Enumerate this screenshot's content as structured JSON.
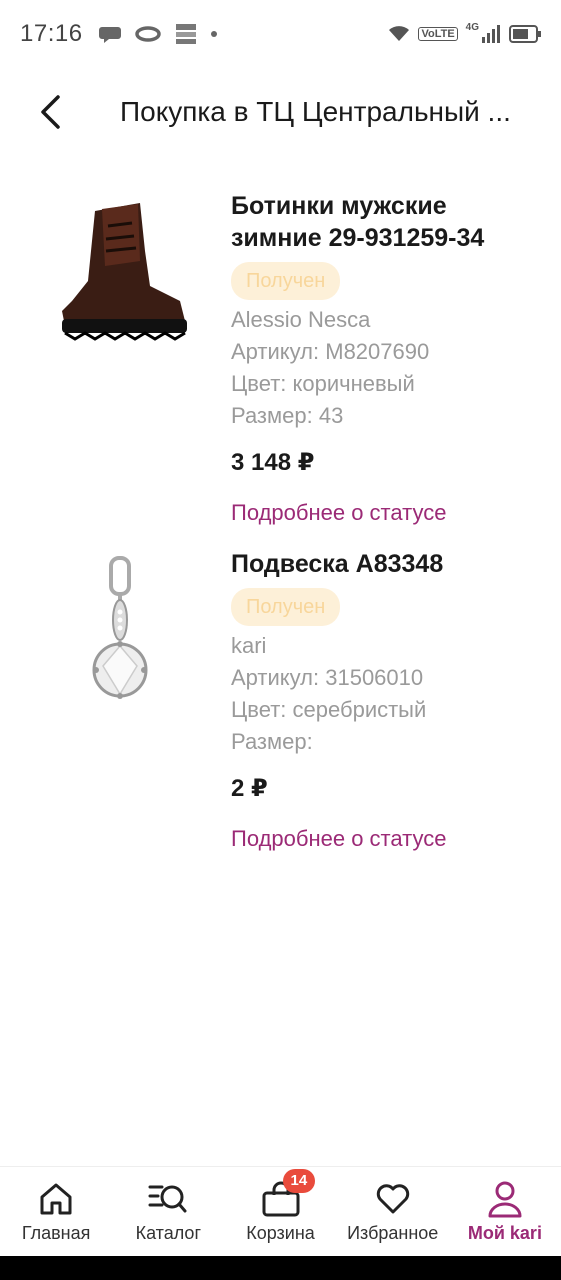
{
  "status_bar": {
    "time": "17:16",
    "network_label": "VoLTE",
    "network_gen": "4G"
  },
  "header": {
    "title": "Покупка в ТЦ Центральный ..."
  },
  "items": [
    {
      "name": "Ботинки мужские зимние 29-931259-34",
      "status": "Получен",
      "brand": "Alessio Nesca",
      "article": "Артикул: M8207690",
      "color": "Цвет: коричневый",
      "size": "Размер: 43",
      "price": "3 148 ₽",
      "link": "Подробнее о статусе",
      "image_icon": "boot-image"
    },
    {
      "name": "Подвеска A83348",
      "status": "Получен",
      "brand": "kari",
      "article": "Артикул: 31506010",
      "color": "Цвет: серебристый",
      "size": "Размер:",
      "price": "2 ₽",
      "link": "Подробнее о статусе",
      "image_icon": "pendant-image"
    }
  ],
  "bottom_nav": {
    "items": [
      {
        "label": "Главная",
        "icon": "home-icon"
      },
      {
        "label": "Каталог",
        "icon": "catalog-search-icon"
      },
      {
        "label": "Корзина",
        "icon": "cart-bag-icon",
        "badge": "14"
      },
      {
        "label": "Избранное",
        "icon": "heart-icon"
      },
      {
        "label": "Мой kari",
        "icon": "profile-icon",
        "active": true
      }
    ]
  },
  "colors": {
    "accent": "#9b2a76",
    "badge_bg": "#fdf0d8",
    "badge_text": "#f8d69b",
    "cart_badge": "#e94b3c"
  }
}
